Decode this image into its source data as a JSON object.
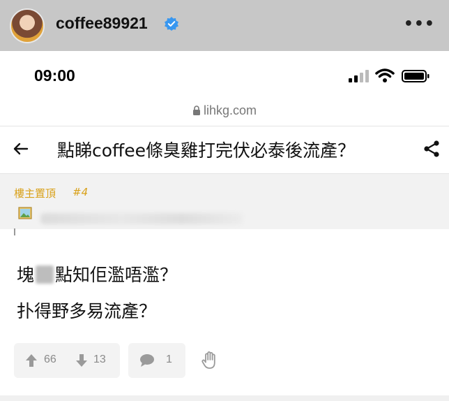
{
  "instagram": {
    "username": "coffee89921",
    "more_label": "•••",
    "verified_color": "#3897f0"
  },
  "status_bar": {
    "time": "09:00"
  },
  "browser": {
    "url": "lihkg.com"
  },
  "thread": {
    "title": "點睇coffee條臭雞打完伏必泰後流產？"
  },
  "quote": {
    "op_label": "樓主置頂",
    "floor": "#4"
  },
  "post": {
    "line1_before": "塊",
    "line1_after": "點知佢濫唔濫？",
    "line2": "扑得野多易流產？"
  },
  "actions": {
    "upvotes": "66",
    "downvotes": "13",
    "comments": "1"
  },
  "colors": {
    "accent_gold": "#d9a11a",
    "icon_gray": "#9a9a9a"
  }
}
